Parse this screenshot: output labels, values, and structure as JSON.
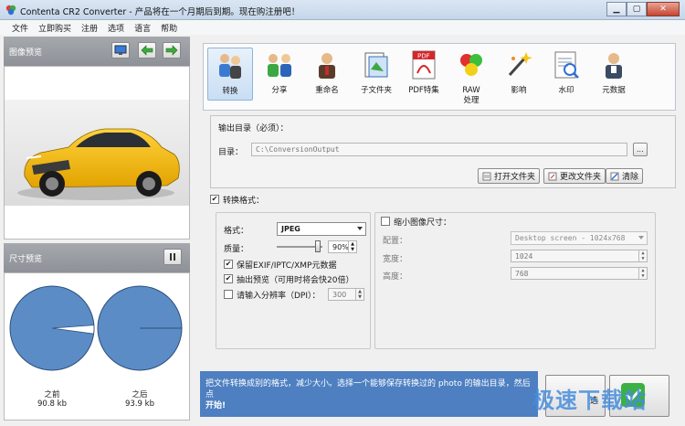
{
  "window": {
    "title": "Contenta CR2 Converter - 产品将在一个月期后到期。现在购注册吧！",
    "minimize_icon": "minimize-icon",
    "maximize_icon": "maximize-icon",
    "close_icon": "close-icon"
  },
  "menu": [
    "文件",
    "立即购买",
    "注册",
    "选项",
    "语言",
    "帮助"
  ],
  "image_preview": {
    "title": "图像预览",
    "buttons": [
      "monitor-icon",
      "arrow-left-icon",
      "arrow-right-icon"
    ]
  },
  "size_preview": {
    "title": "尺寸预览",
    "pause_icon": "pause-icon",
    "before_label": "之前",
    "before_value": "90.8 kb",
    "after_label": "之后",
    "after_value": "93.9 kb",
    "before_fraction": 0.967,
    "after_fraction": 1.0,
    "pie_color": "#5b8cc6"
  },
  "toolbar": [
    {
      "label": "转换",
      "icon": "convert-people-icon",
      "active": true
    },
    {
      "label": "分享",
      "icon": "share-people-icon",
      "active": false
    },
    {
      "label": "重命名",
      "icon": "rename-person-icon",
      "active": false
    },
    {
      "label": "子文件夹",
      "icon": "subfolder-icon",
      "active": false
    },
    {
      "label": "PDF特集",
      "icon": "pdf-icon",
      "active": false
    },
    {
      "label": "RAW\n处理",
      "icon": "raw-balls-icon",
      "active": false
    },
    {
      "label": "影响",
      "icon": "effects-wand-icon",
      "active": false
    },
    {
      "label": "水印",
      "icon": "watermark-icon",
      "active": false
    },
    {
      "label": "元数据",
      "icon": "metadata-person-icon",
      "active": false
    }
  ],
  "output": {
    "section_title": "输出目录（必须）：",
    "dir_label": "目录：",
    "dir_value": "C:\\ConversionOutput",
    "browse_label": "...",
    "open_folder": "打开文件夹",
    "change_folder": "更改文件夹",
    "clear": "清除"
  },
  "convert": {
    "checkbox_label": "转换格式：",
    "checked": true,
    "format_label": "格式：",
    "format_value": "JPEG",
    "quality_label": "质量：",
    "quality_value": "90%",
    "quality_level": 0.9,
    "keep_meta_label": "保留EXIF/IPTC/XMP元数据",
    "keep_meta_checked": true,
    "extract_preview_label": "抽出预览（可用时将会快20倍）",
    "extract_preview_checked": true,
    "dpi_label": "请输入分辨率（DPI）：",
    "dpi_checked": false,
    "dpi_value": "300"
  },
  "resize": {
    "checkbox_label": "缩小图像尺寸：",
    "checked": false,
    "config_label": "配置：",
    "config_value": "Desktop screen - 1024x768",
    "width_label": "宽度：",
    "width_value": "1024",
    "height_label": "高度：",
    "height_value": "768"
  },
  "info_text": "把文件转换成别的格式，减少大小。选择一个能够保存转换过的 photo 的输出目录，然后点",
  "info_text_bold": "开始!",
  "start_button_partial": "选",
  "watermark_text": "极速下载站"
}
